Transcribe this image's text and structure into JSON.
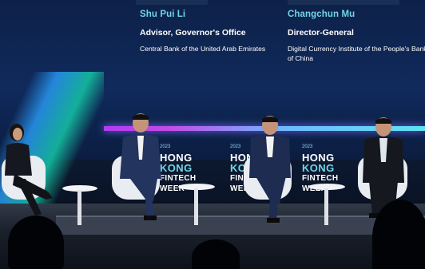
{
  "speakers": [
    {
      "name": "Shu Pui Li",
      "role": "Advisor, Governor's Office",
      "org": "Central Bank of the United Arab Emirates"
    },
    {
      "name": "Changchun Mu",
      "role": "Director-General",
      "org": "Digital Currency Institute of the People's Bank of China"
    }
  ],
  "logo": {
    "year": "2023",
    "line1a": "HONG",
    "line1b": "KONG",
    "line2": "FINTECH",
    "line3": "WEEK"
  },
  "colors": {
    "accent": "#6fd6e8",
    "screen": "#102a5c",
    "neon": "#c44be8"
  }
}
